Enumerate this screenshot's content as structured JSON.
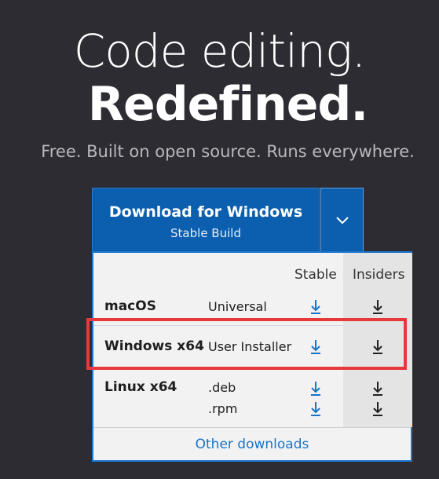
{
  "hero": {
    "line1": "Code editing.",
    "line2": "Redefined.",
    "tagline": "Free. Built on open source. Runs everywhere."
  },
  "download_button": {
    "title": "Download for Windows",
    "subtitle": "Stable Build",
    "toggle_icon": "chevron-down-icon"
  },
  "panel": {
    "columns": {
      "stable": "Stable",
      "insiders": "Insiders"
    },
    "rows": [
      {
        "os": "macOS",
        "variants": [
          "Universal"
        ]
      },
      {
        "os": "Windows x64",
        "variants": [
          "User Installer"
        ]
      },
      {
        "os": "Linux x64",
        "variants": [
          ".deb",
          ".rpm"
        ]
      }
    ],
    "other_downloads": "Other downloads"
  },
  "colors": {
    "background": "#2c2c32",
    "button": "#0b5fae",
    "link": "#1a73c9",
    "highlight": "#e8393a"
  }
}
